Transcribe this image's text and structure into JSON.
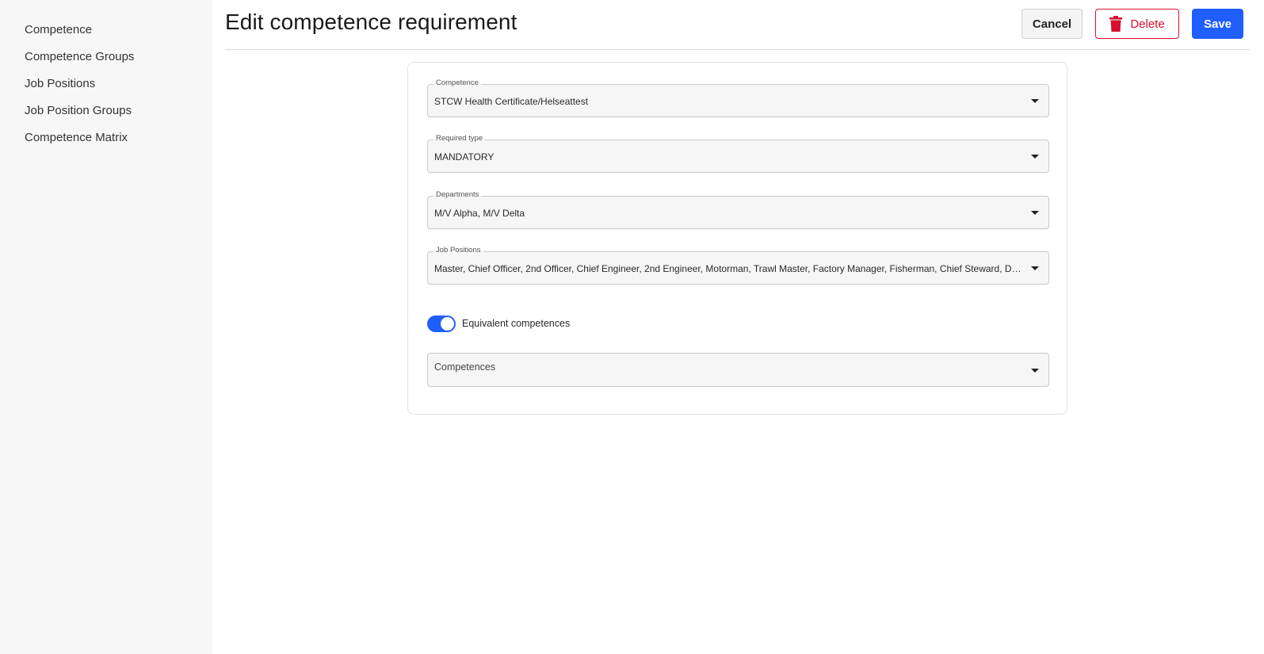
{
  "sidebar": {
    "items": [
      {
        "label": "Competence"
      },
      {
        "label": "Competence Groups"
      },
      {
        "label": "Job Positions"
      },
      {
        "label": "Job Position Groups"
      },
      {
        "label": "Competence Matrix"
      }
    ]
  },
  "header": {
    "title": "Edit competence requirement",
    "cancel_label": "Cancel",
    "delete_label": "Delete",
    "save_label": "Save"
  },
  "form": {
    "competence": {
      "label": "Competence",
      "value": "STCW Health Certificate/Helseattest"
    },
    "required_type": {
      "label": "Required type",
      "value": "MANDATORY"
    },
    "departments": {
      "label": "Departments",
      "value": "M/V Alpha, M/V Delta"
    },
    "job_positions": {
      "label": "Job Positions",
      "value": "Master, Chief Officer, 2nd Officer, Chief Engineer, 2nd Engineer, Motorman, Trawl Master, Factory Manager, Fisherman, Chief Steward, Deck Cadet"
    },
    "equivalent_toggle": {
      "label": "Equivalent competences",
      "on": true
    },
    "competences": {
      "placeholder": "Competences"
    }
  },
  "colors": {
    "primary": "#1f5eff",
    "danger": "#d6102f",
    "sidebar_bg": "#f7f7f7"
  },
  "icons": {
    "delete": "trash-icon",
    "dropdown": "caret-down-icon"
  }
}
